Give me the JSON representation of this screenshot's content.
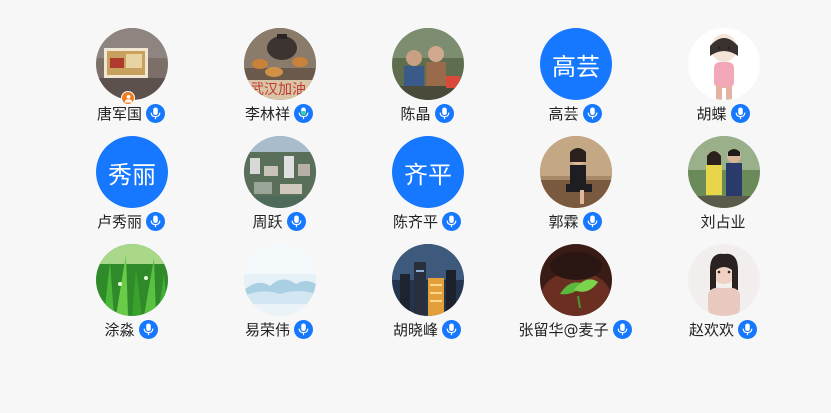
{
  "participants": [
    {
      "name": "唐军国",
      "avatar_text": "",
      "avatar_icon": "painting-photo",
      "mic": true,
      "mic_color": "#1677ff",
      "host": true
    },
    {
      "name": "李林祥",
      "avatar_text": "",
      "avatar_icon": "tea-set-photo",
      "mic": true,
      "mic_color": "#1677ff",
      "mic_active_color": "#36d399",
      "host": false
    },
    {
      "name": "陈晶",
      "avatar_text": "",
      "avatar_icon": "people-photo",
      "mic": true,
      "mic_color": "#1677ff",
      "host": false
    },
    {
      "name": "高芸",
      "avatar_text": "高芸",
      "avatar_icon": "",
      "avatar_color": "#1677ff",
      "mic": true,
      "mic_color": "#1677ff",
      "host": false
    },
    {
      "name": "胡蝶",
      "avatar_text": "",
      "avatar_icon": "cartoon-girl-photo",
      "mic": true,
      "mic_color": "#1677ff",
      "host": false
    },
    {
      "name": "卢秀丽",
      "avatar_text": "秀丽",
      "avatar_icon": "",
      "avatar_color": "#1677ff",
      "mic": true,
      "mic_color": "#1677ff",
      "host": false
    },
    {
      "name": "周跃",
      "avatar_text": "",
      "avatar_icon": "city-aerial-photo",
      "mic": true,
      "mic_color": "#1677ff",
      "host": false
    },
    {
      "name": "陈齐平",
      "avatar_text": "齐平",
      "avatar_icon": "",
      "avatar_color": "#1677ff",
      "mic": true,
      "mic_color": "#1677ff",
      "host": false
    },
    {
      "name": "郭霖",
      "avatar_text": "",
      "avatar_icon": "woman-seated-photo",
      "mic": true,
      "mic_color": "#1677ff",
      "host": false
    },
    {
      "name": "刘占业",
      "avatar_text": "",
      "avatar_icon": "couple-photo",
      "mic": false,
      "host": false
    },
    {
      "name": "涂淼",
      "avatar_text": "",
      "avatar_icon": "grass-photo",
      "mic": true,
      "mic_color": "#1677ff",
      "host": false
    },
    {
      "name": "易荣伟",
      "avatar_text": "",
      "avatar_icon": "misty-mountain-photo",
      "mic": true,
      "mic_color": "#1677ff",
      "host": false
    },
    {
      "name": "胡晓峰",
      "avatar_text": "",
      "avatar_icon": "night-city-photo",
      "mic": true,
      "mic_color": "#1677ff",
      "host": false
    },
    {
      "name": "张留华@麦子",
      "avatar_text": "",
      "avatar_icon": "tea-leaves-photo",
      "mic": true,
      "mic_color": "#1677ff",
      "host": false
    },
    {
      "name": "赵欢欢",
      "avatar_text": "",
      "avatar_icon": "woman-portrait-photo",
      "mic": true,
      "mic_color": "#1677ff",
      "host": false
    }
  ]
}
